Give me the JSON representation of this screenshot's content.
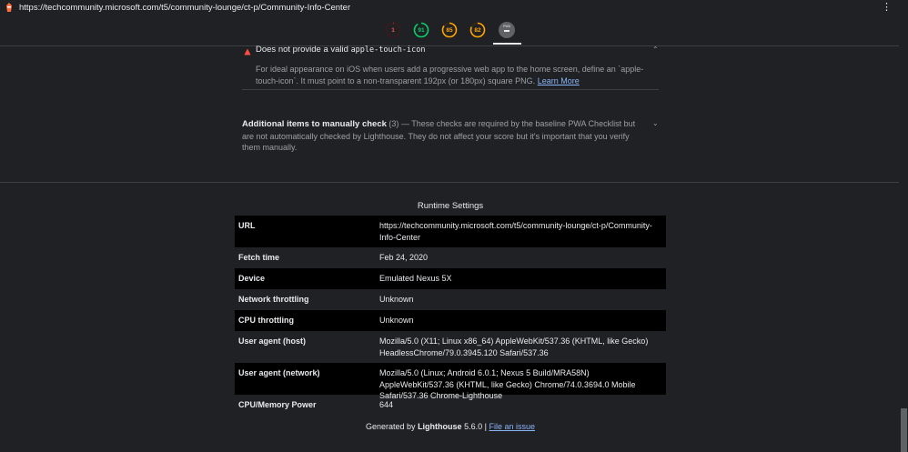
{
  "browser": {
    "url": "https://techcommunity.microsoft.com/t5/community-lounge/ct-p/Community-Info-Center"
  },
  "gauges": [
    {
      "label": "1",
      "score": 1,
      "color": "#ff4e42"
    },
    {
      "label": "91",
      "score": 91,
      "color": "#0cce6b"
    },
    {
      "label": "85",
      "score": 85,
      "color": "#ffa400"
    },
    {
      "label": "82",
      "score": 82,
      "color": "#ffa400"
    }
  ],
  "pwa_badge": {
    "label": "PWA"
  },
  "audit": {
    "title_prefix": "Does not provide a valid ",
    "title_code": "apple-touch-icon",
    "desc_text": "For ideal appearance on iOS when users add a progressive web app to the home screen, define an `apple-touch-icon`. It must point to a non-transparent 192px (or 180px) square PNG.",
    "learn_more": "Learn More"
  },
  "manual": {
    "title": "Additional items to manually check",
    "count": "(3)",
    "desc_before": "— These checks are required by the baseline",
    "link": "PWA Checklist",
    "desc_after": "but are not automatically checked by Lighthouse. They do not affect your score but it's important that you verify them manually."
  },
  "runtime": {
    "title": "Runtime Settings",
    "rows": [
      {
        "key": "URL",
        "value": "https://techcommunity.microsoft.com/t5/community-lounge/ct-p/Community-Info-Center"
      },
      {
        "key": "Fetch time",
        "value": "Feb 24, 2020"
      },
      {
        "key": "Device",
        "value": "Emulated Nexus 5X"
      },
      {
        "key": "Network throttling",
        "value": "Unknown"
      },
      {
        "key": "CPU throttling",
        "value": "Unknown"
      },
      {
        "key": "User agent (host)",
        "value": "Mozilla/5.0 (X11; Linux x86_64) AppleWebKit/537.36 (KHTML, like Gecko) HeadlessChrome/79.0.3945.120 Safari/537.36"
      },
      {
        "key": "User agent (network)",
        "value": "Mozilla/5.0 (Linux; Android 6.0.1; Nexus 5 Build/MRA58N) AppleWebKit/537.36 (KHTML, like Gecko) Chrome/74.0.3694.0 Mobile Safari/537.36 Chrome-Lighthouse"
      },
      {
        "key": "CPU/Memory Power",
        "value": "644"
      }
    ]
  },
  "footer": {
    "generated_by": "Generated by",
    "brand": "Lighthouse",
    "version": "5.6.0 |",
    "issue_link": "File an issue"
  }
}
